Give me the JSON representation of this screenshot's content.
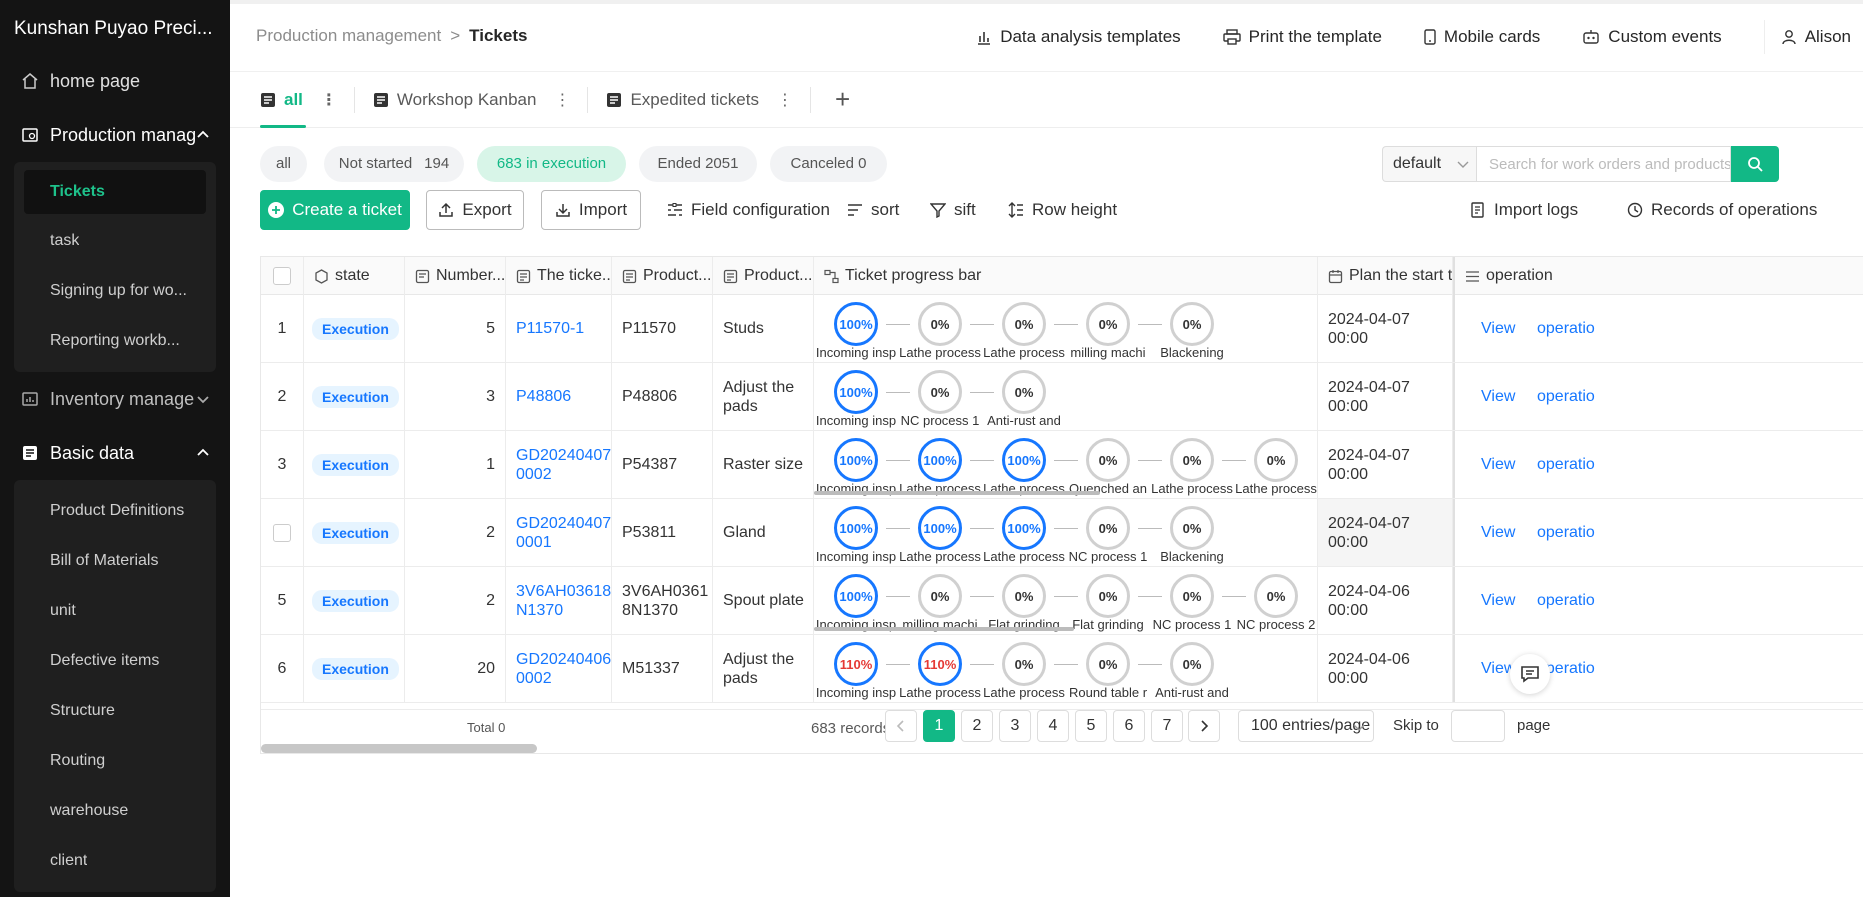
{
  "app": {
    "title": "Kunshan Puyao Preci..."
  },
  "sidebar": {
    "home": "home page",
    "production": "Production manag",
    "production_items": [
      "Tickets",
      "task",
      "Signing up for wo...",
      "Reporting workb..."
    ],
    "inventory": "Inventory manage",
    "basic": "Basic data",
    "basic_items": [
      "Product Definitions",
      "Bill of Materials",
      "unit",
      "Defective items",
      "Structure",
      "Routing",
      "warehouse",
      "client"
    ]
  },
  "breadcrumb": {
    "parent": "Production management",
    "sep": ">",
    "current": "Tickets"
  },
  "top_actions": {
    "analysis": "Data analysis templates",
    "print": "Print the template",
    "mobile": "Mobile cards",
    "events": "Custom events",
    "user": "Alison"
  },
  "view_tabs": {
    "all": "all",
    "kanban": "Workshop Kanban",
    "expedited": "Expedited tickets",
    "add": "+"
  },
  "filters": {
    "all": "all",
    "not_started": "Not started",
    "not_started_count": "194",
    "execution": "683 in execution",
    "ended": "Ended 2051",
    "canceled": "Canceled 0"
  },
  "view_select": "default",
  "search": {
    "placeholder": "Search for work orders and products"
  },
  "toolbar": {
    "create": "Create a ticket",
    "export": "Export",
    "import": "Import",
    "field_config": "Field configuration",
    "sort": "sort",
    "sift": "sift",
    "row_height": "Row height",
    "import_logs": "Import logs",
    "records_ops": "Records of operations"
  },
  "columns": {
    "state": "state",
    "number": "Number...",
    "ticket": "The ticke...",
    "product_code": "Product...",
    "product_name": "Product...",
    "progress": "Ticket progress bar",
    "plan_start": "Plan the start ti",
    "operation": "operation"
  },
  "rows": [
    {
      "idx": "1",
      "state": "Execution",
      "number": "5",
      "ticket": "P11570-1",
      "product_code": "P11570",
      "product_name": "Studs",
      "plan_start": "2024-04-07 00:00",
      "view": "View",
      "op": "operatio",
      "steps": [
        {
          "pct": "100%",
          "label": "Incoming insp",
          "kind": "full"
        },
        {
          "pct": "0%",
          "label": "Lathe process",
          "kind": "zero"
        },
        {
          "pct": "0%",
          "label": "Lathe process",
          "kind": "zero"
        },
        {
          "pct": "0%",
          "label": "milling machi",
          "kind": "zero"
        },
        {
          "pct": "0%",
          "label": "Blackening",
          "kind": "zero"
        }
      ],
      "scroll": false
    },
    {
      "idx": "2",
      "state": "Execution",
      "number": "3",
      "ticket": "P48806",
      "product_code": "P48806",
      "product_name": "Adjust the pads",
      "plan_start": "2024-04-07 00:00",
      "view": "View",
      "op": "operatio",
      "steps": [
        {
          "pct": "100%",
          "label": "Incoming insp",
          "kind": "full"
        },
        {
          "pct": "0%",
          "label": "NC process 1",
          "kind": "zero"
        },
        {
          "pct": "0%",
          "label": "Anti-rust and",
          "kind": "zero"
        }
      ],
      "scroll": false
    },
    {
      "idx": "3",
      "state": "Execution",
      "number": "1",
      "ticket": "GD20240407 0002",
      "product_code": "P54387",
      "product_name": "Raster size",
      "plan_start": "2024-04-07 00:00",
      "view": "View",
      "op": "operatio",
      "steps": [
        {
          "pct": "100%",
          "label": "Incoming insp",
          "kind": "full"
        },
        {
          "pct": "100%",
          "label": "Lathe process",
          "kind": "full"
        },
        {
          "pct": "100%",
          "label": "Lathe process",
          "kind": "full"
        },
        {
          "pct": "0%",
          "label": "Quenched an",
          "kind": "zero"
        },
        {
          "pct": "0%",
          "label": "Lathe process",
          "kind": "zero"
        },
        {
          "pct": "0%",
          "label": "Lathe process",
          "kind": "zero"
        }
      ],
      "scroll": true
    },
    {
      "idx": "",
      "state": "Execution",
      "number": "2",
      "ticket": "GD20240407 0001",
      "product_code": "P53811",
      "product_name": "Gland",
      "plan_start": "2024-04-07 00:00",
      "view": "View",
      "op": "operatio",
      "steps": [
        {
          "pct": "100%",
          "label": "Incoming insp",
          "kind": "full"
        },
        {
          "pct": "100%",
          "label": "Lathe process",
          "kind": "full"
        },
        {
          "pct": "100%",
          "label": "Lathe process",
          "kind": "full"
        },
        {
          "pct": "0%",
          "label": "NC process 1",
          "kind": "zero"
        },
        {
          "pct": "0%",
          "label": "Blackening",
          "kind": "zero"
        }
      ],
      "scroll": false
    },
    {
      "idx": "5",
      "state": "Execution",
      "number": "2",
      "ticket": "3V6AH03618 N1370",
      "product_code": "3V6AH0361 8N1370",
      "product_name": "Spout plate",
      "plan_start": "2024-04-06 00:00",
      "view": "View",
      "op": "operatio",
      "steps": [
        {
          "pct": "100%",
          "label": "Incoming insp",
          "kind": "full"
        },
        {
          "pct": "0%",
          "label": "milling machi",
          "kind": "zero"
        },
        {
          "pct": "0%",
          "label": "Flat grinding",
          "kind": "zero"
        },
        {
          "pct": "0%",
          "label": "Flat grinding",
          "kind": "zero"
        },
        {
          "pct": "0%",
          "label": "NC process 1",
          "kind": "zero"
        },
        {
          "pct": "0%",
          "label": "NC process 2",
          "kind": "zero"
        }
      ],
      "scroll": true
    },
    {
      "idx": "6",
      "state": "Execution",
      "number": "20",
      "ticket": "GD20240406 0002",
      "product_code": "M51337",
      "product_name": "Adjust the pads",
      "plan_start": "2024-04-06 00:00",
      "view": "View",
      "op": "operatio",
      "steps": [
        {
          "pct": "110%",
          "label": "Incoming insp",
          "kind": "over"
        },
        {
          "pct": "110%",
          "label": "Lathe process",
          "kind": "over"
        },
        {
          "pct": "0%",
          "label": "Lathe process",
          "kind": "zero"
        },
        {
          "pct": "0%",
          "label": "Round table r",
          "kind": "zero"
        },
        {
          "pct": "0%",
          "label": "Anti-rust and",
          "kind": "zero"
        }
      ],
      "scroll": false
    }
  ],
  "footer": {
    "total": "Total 0"
  },
  "pager": {
    "records": "683 records",
    "pages": [
      "1",
      "2",
      "3",
      "4",
      "5",
      "6",
      "7"
    ],
    "page_size": "100 entries/page",
    "skip_to": "Skip to",
    "page_label": "page"
  }
}
